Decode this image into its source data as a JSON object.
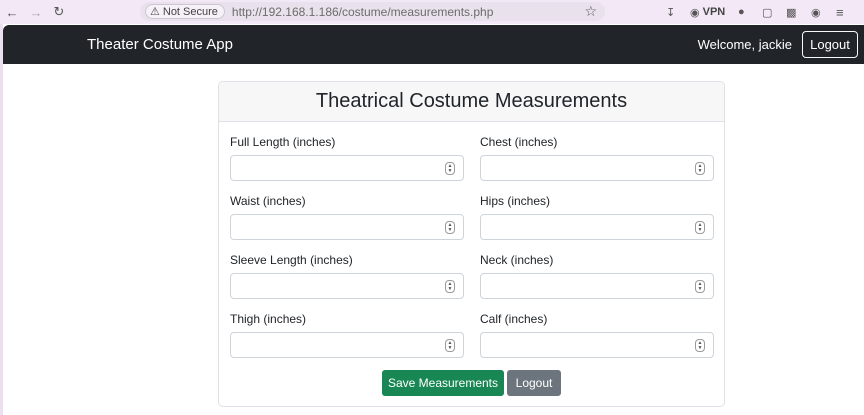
{
  "browser": {
    "not_secure_label": "Not Secure",
    "url": "http://192.168.1.186/costume/measurements.php",
    "vpn_label": "VPN"
  },
  "navbar": {
    "brand": "Theater Costume App",
    "welcome": "Welcome, jackie",
    "logout_label": "Logout"
  },
  "card": {
    "title": "Theatrical Costume Measurements",
    "fields": [
      {
        "label": "Full Length (inches)",
        "value": ""
      },
      {
        "label": "Chest (inches)",
        "value": ""
      },
      {
        "label": "Waist (inches)",
        "value": ""
      },
      {
        "label": "Hips (inches)",
        "value": ""
      },
      {
        "label": "Sleeve Length (inches)",
        "value": ""
      },
      {
        "label": "Neck (inches)",
        "value": ""
      },
      {
        "label": "Thigh (inches)",
        "value": ""
      },
      {
        "label": "Calf (inches)",
        "value": ""
      }
    ],
    "save_label": "Save Measurements",
    "logout_label": "Logout"
  },
  "colors": {
    "navbar_bg": "#212529",
    "save_button": "#198754",
    "logout_button": "#6c757d"
  }
}
